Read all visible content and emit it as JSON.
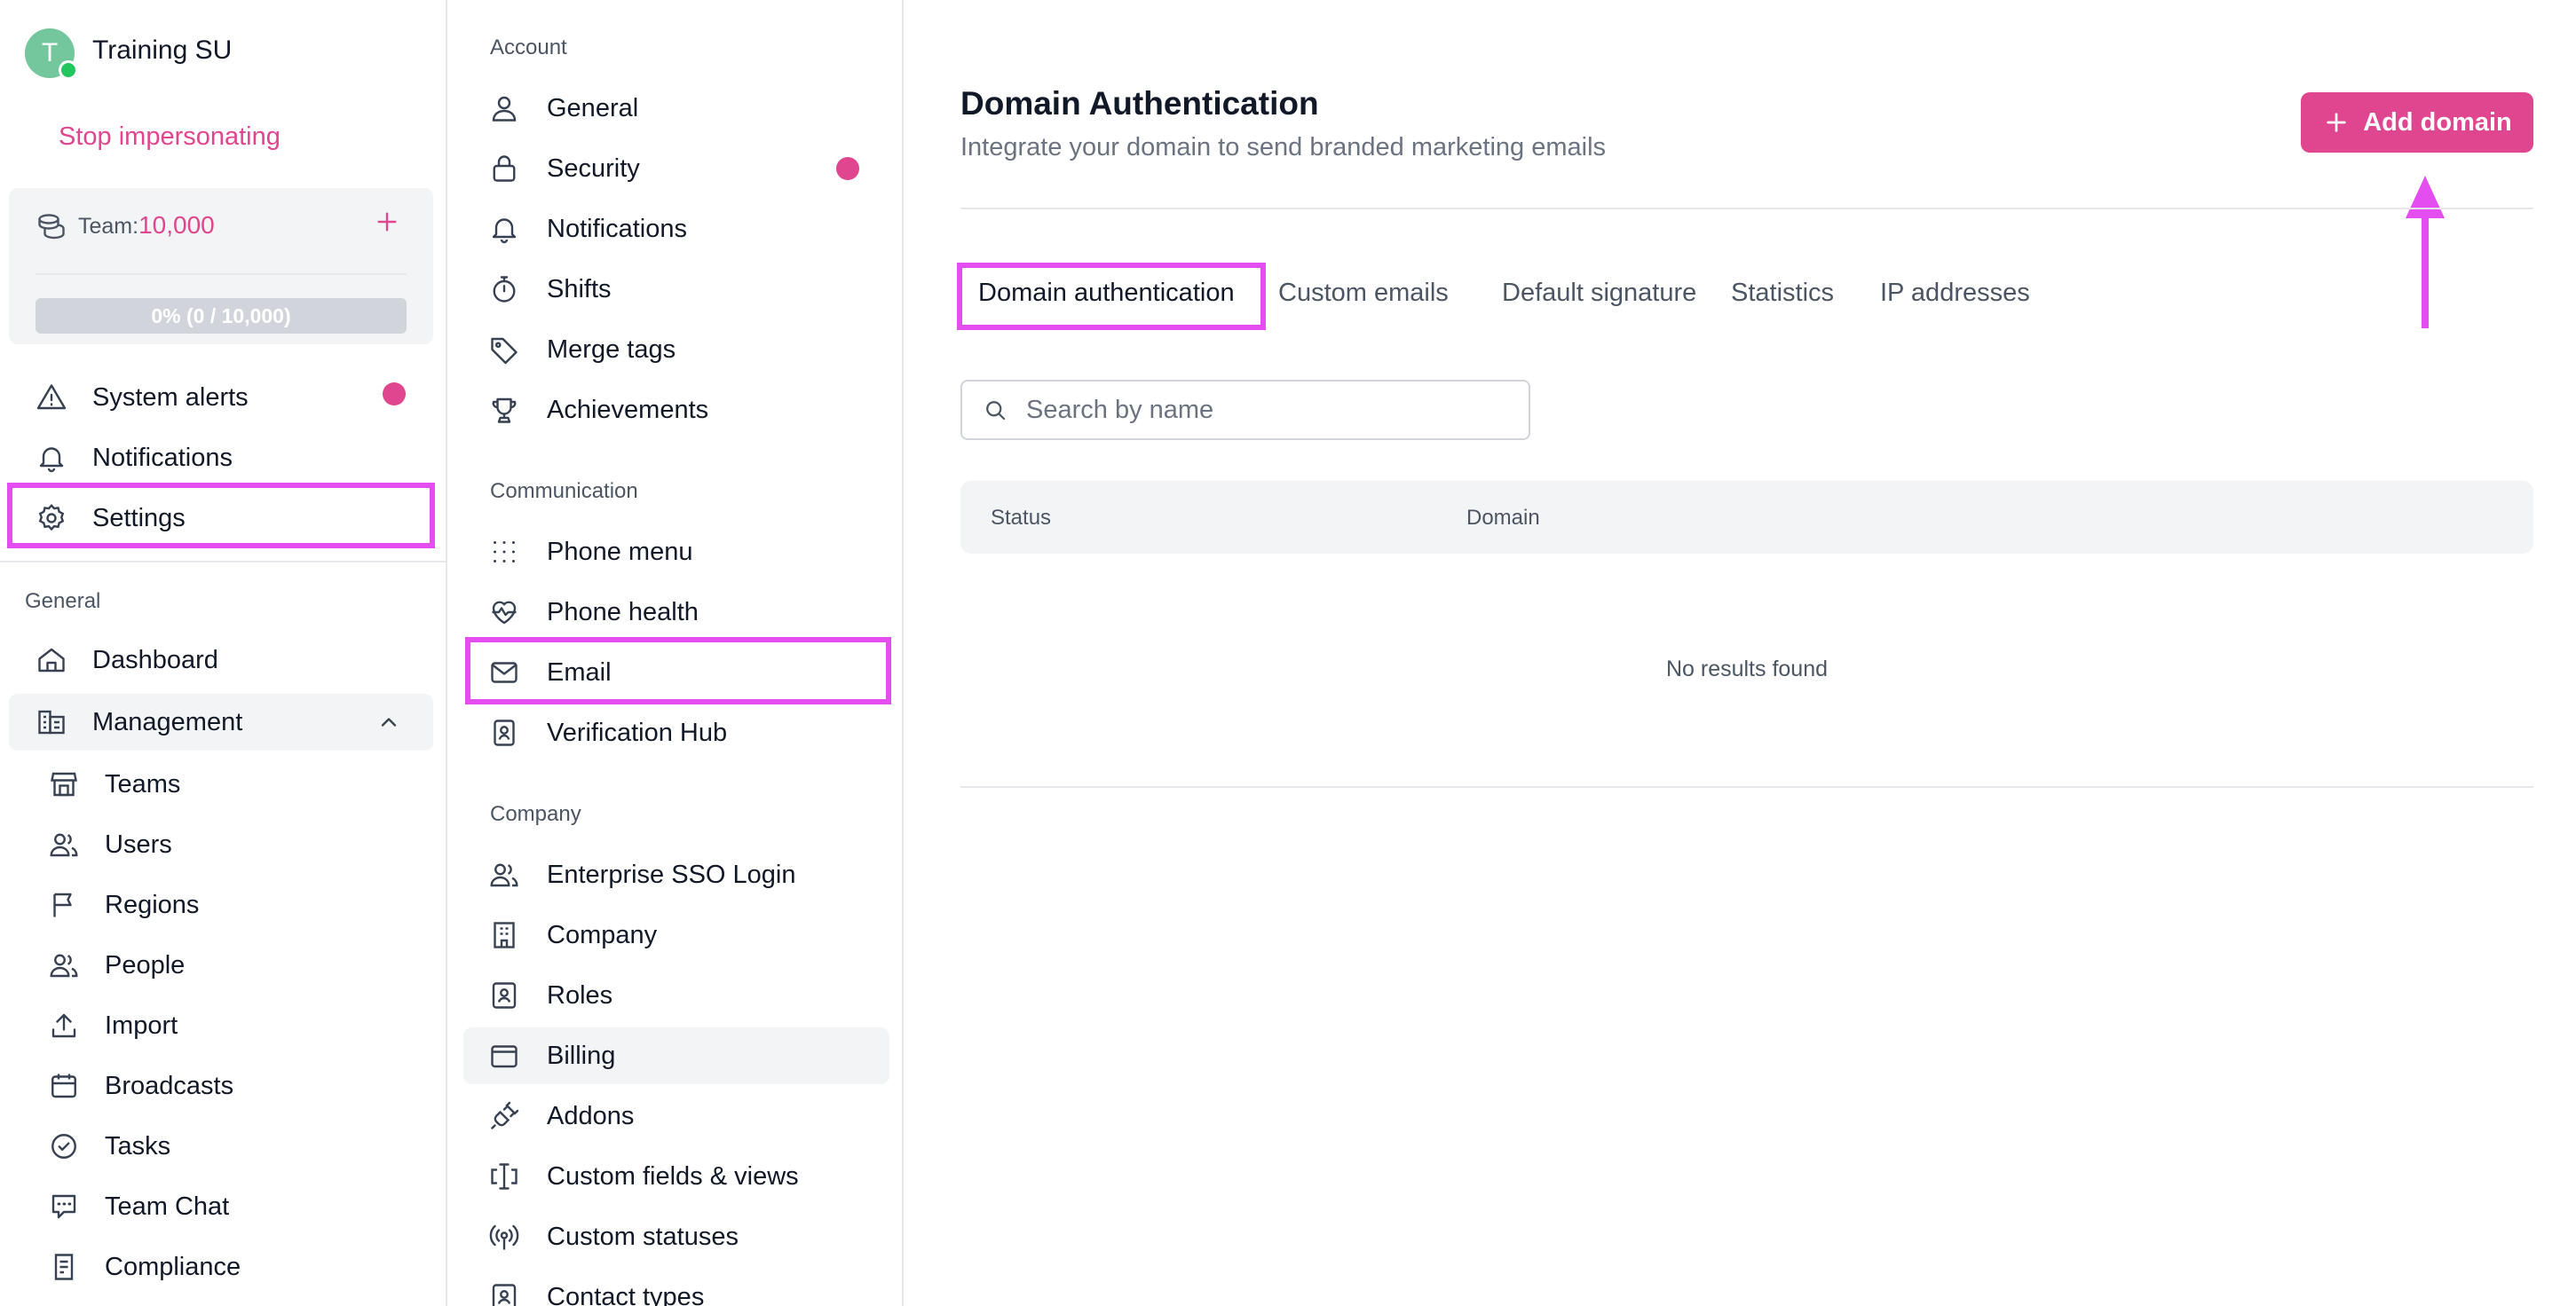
{
  "user": {
    "initial": "T",
    "name": "Training SU",
    "stop_impersonating": "Stop impersonating"
  },
  "team_card": {
    "label": "Team:",
    "value": "10,000",
    "progress_text": "0% (0 / 10,000)",
    "progress_fraction": 0
  },
  "sidebar": {
    "top_items": [
      {
        "label": "System alerts",
        "icon": "alert-triangle-icon",
        "has_dot": true
      },
      {
        "label": "Notifications",
        "icon": "bell-icon"
      },
      {
        "label": "Settings",
        "icon": "gear-icon",
        "highlighted": true
      }
    ],
    "general_heading": "General",
    "general_items": [
      {
        "label": "Dashboard",
        "icon": "home-icon"
      },
      {
        "label": "Management",
        "icon": "building-icon",
        "expanded": true
      },
      {
        "label": "Teams",
        "icon": "store-icon"
      },
      {
        "label": "Users",
        "icon": "users-icon"
      },
      {
        "label": "Regions",
        "icon": "flag-icon"
      },
      {
        "label": "People",
        "icon": "people-icon"
      },
      {
        "label": "Import",
        "icon": "upload-icon"
      },
      {
        "label": "Broadcasts",
        "icon": "calendar-icon"
      },
      {
        "label": "Tasks",
        "icon": "check-circle-icon"
      },
      {
        "label": "Team Chat",
        "icon": "chat-icon"
      },
      {
        "label": "Compliance",
        "icon": "compliance-icon"
      }
    ]
  },
  "settings_nav": {
    "account_heading": "Account",
    "account_items": [
      {
        "label": "General",
        "icon": "person-icon"
      },
      {
        "label": "Security",
        "icon": "lock-icon",
        "has_dot": true
      },
      {
        "label": "Notifications",
        "icon": "bell-icon"
      },
      {
        "label": "Shifts",
        "icon": "stopwatch-icon"
      },
      {
        "label": "Merge tags",
        "icon": "tag-icon"
      },
      {
        "label": "Achievements",
        "icon": "trophy-icon"
      }
    ],
    "communication_heading": "Communication",
    "communication_items": [
      {
        "label": "Phone menu",
        "icon": "grid-dots-icon"
      },
      {
        "label": "Phone health",
        "icon": "heartbeat-icon"
      },
      {
        "label": "Email",
        "icon": "mail-icon",
        "highlighted": true
      },
      {
        "label": "Verification Hub",
        "icon": "id-badge-icon"
      }
    ],
    "company_heading": "Company",
    "company_items": [
      {
        "label": "Enterprise SSO Login",
        "icon": "users-icon"
      },
      {
        "label": "Company",
        "icon": "office-icon"
      },
      {
        "label": "Roles",
        "icon": "contact-card-icon"
      },
      {
        "label": "Billing",
        "icon": "wallet-icon",
        "hovered": true
      },
      {
        "label": "Addons",
        "icon": "plug-icon"
      },
      {
        "label": "Custom fields & views",
        "icon": "text-cursor-icon"
      },
      {
        "label": "Custom statuses",
        "icon": "broadcast-icon"
      },
      {
        "label": "Contact types",
        "icon": "contact-card-icon"
      }
    ]
  },
  "main": {
    "title": "Domain Authentication",
    "subtitle": "Integrate your domain to send branded marketing emails",
    "add_button": "Add domain",
    "tabs": [
      {
        "label": "Domain authentication",
        "active": true
      },
      {
        "label": "Custom emails"
      },
      {
        "label": "Default signature"
      },
      {
        "label": "Statistics"
      },
      {
        "label": "IP addresses"
      }
    ],
    "search_placeholder": "Search by name",
    "table_headers": [
      "Status",
      "Domain"
    ],
    "empty_text": "No results found"
  },
  "colors": {
    "accent": "#e0458f",
    "highlight": "#e44ef0",
    "avatar": "#74c69d"
  }
}
